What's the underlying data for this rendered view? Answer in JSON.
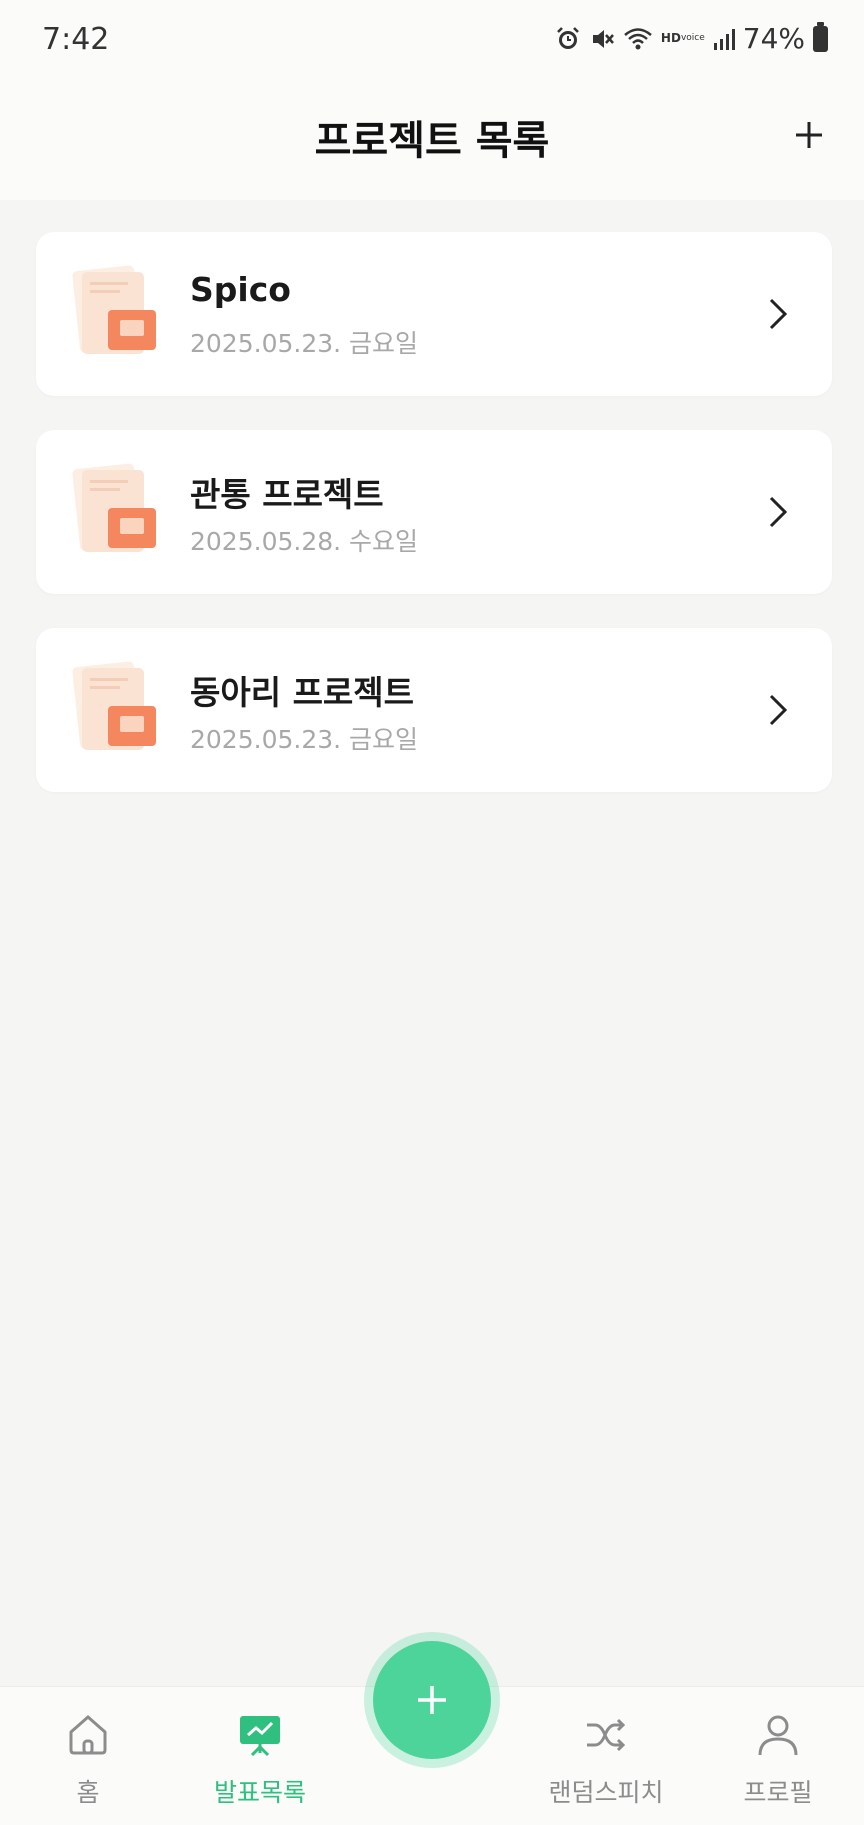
{
  "status_bar": {
    "time": "7:42",
    "hd_top": "HD",
    "hd_bottom": "voice",
    "battery": "74%",
    "icons": [
      "alarm-icon",
      "mute-icon",
      "wifi-icon",
      "hd-voice-icon",
      "signal-icon",
      "battery-icon"
    ]
  },
  "header": {
    "title": "프로젝트 목록",
    "add_icon": "plus-icon"
  },
  "projects": [
    {
      "title": "Spico",
      "date": "2025.05.23. 금요일"
    },
    {
      "title": "관통 프로젝트",
      "date": "2025.05.28. 수요일"
    },
    {
      "title": "동아리 프로젝트",
      "date": "2025.05.23. 금요일"
    }
  ],
  "bottom_nav": {
    "items": [
      {
        "label": "홈",
        "icon": "home-icon",
        "active": false
      },
      {
        "label": "발표목록",
        "icon": "presentation-icon",
        "active": true
      },
      {
        "label": "랜덤스피치",
        "icon": "shuffle-icon",
        "active": false
      },
      {
        "label": "프로필",
        "icon": "user-icon",
        "active": false
      }
    ],
    "fab_icon": "plus-icon"
  },
  "colors": {
    "accent": "#4cd49a",
    "active_nav": "#2fbf7f",
    "doc_orange": "#f5875f",
    "background": "#f5f6f4"
  }
}
